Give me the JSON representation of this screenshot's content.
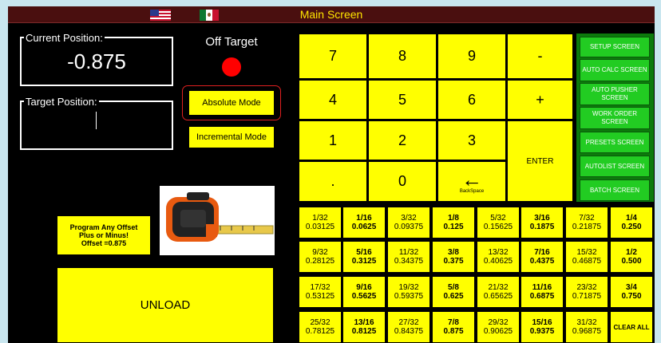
{
  "title": "Main Screen",
  "current": {
    "label": "Current Position:",
    "value": "-0.875"
  },
  "target": {
    "label": "Target Position:"
  },
  "status": {
    "text": "Off Target",
    "color": "#ff0000"
  },
  "modes": {
    "absolute": "Absolute Mode",
    "incremental": "Incremental Mode"
  },
  "keypad": {
    "k7": "7",
    "k8": "8",
    "k9": "9",
    "minus": "-",
    "k4": "4",
    "k5": "5",
    "k6": "6",
    "plus": "+",
    "k1": "1",
    "k2": "2",
    "k3": "3",
    "enter": "ENTER",
    "dot": ".",
    "k0": "0",
    "back_arrow": "←",
    "backspace": "BackSpace"
  },
  "screens": {
    "setup": "SETUP SCREEN",
    "auto_calc": "AUTO CALC SCREEN",
    "auto_pusher": "AUTO PUSHER SCREEN",
    "work_order": "WORK ORDER SCREEN",
    "presets": "PRESETS SCREEN",
    "autolist": "AUTOLIST SCREEN",
    "batch": "BATCH SCREEN"
  },
  "offset": {
    "line1": "Program Any Offset",
    "line2": "Plus or Minus!",
    "line3": "Offset =0.875"
  },
  "unload": "UNLOAD",
  "fractions": {
    "f1": {
      "num": "1/32",
      "dec": "0.03125"
    },
    "f2": {
      "num": "1/16",
      "dec": "0.0625"
    },
    "f3": {
      "num": "3/32",
      "dec": "0.09375"
    },
    "f4": {
      "num": "1/8",
      "dec": "0.125"
    },
    "f5": {
      "num": "5/32",
      "dec": "0.15625"
    },
    "f6": {
      "num": "3/16",
      "dec": "0.1875"
    },
    "f7": {
      "num": "7/32",
      "dec": "0.21875"
    },
    "f8": {
      "num": "1/4",
      "dec": "0.250"
    },
    "f9": {
      "num": "9/32",
      "dec": "0.28125"
    },
    "f10": {
      "num": "5/16",
      "dec": "0.3125"
    },
    "f11": {
      "num": "11/32",
      "dec": "0.34375"
    },
    "f12": {
      "num": "3/8",
      "dec": "0.375"
    },
    "f13": {
      "num": "13/32",
      "dec": "0.40625"
    },
    "f14": {
      "num": "7/16",
      "dec": "0.4375"
    },
    "f15": {
      "num": "15/32",
      "dec": "0.46875"
    },
    "f16": {
      "num": "1/2",
      "dec": "0.500"
    },
    "f17": {
      "num": "17/32",
      "dec": "0.53125"
    },
    "f18": {
      "num": "9/16",
      "dec": "0.5625"
    },
    "f19": {
      "num": "19/32",
      "dec": "0.59375"
    },
    "f20": {
      "num": "5/8",
      "dec": "0.625"
    },
    "f21": {
      "num": "21/32",
      "dec": "0.65625"
    },
    "f22": {
      "num": "11/16",
      "dec": "0.6875"
    },
    "f23": {
      "num": "23/32",
      "dec": "0.71875"
    },
    "f24": {
      "num": "3/4",
      "dec": "0.750"
    },
    "f25": {
      "num": "25/32",
      "dec": "0.78125"
    },
    "f26": {
      "num": "13/16",
      "dec": "0.8125"
    },
    "f27": {
      "num": "27/32",
      "dec": "0.84375"
    },
    "f28": {
      "num": "7/8",
      "dec": "0.875"
    },
    "f29": {
      "num": "29/32",
      "dec": "0.90625"
    },
    "f30": {
      "num": "15/16",
      "dec": "0.9375"
    },
    "f31": {
      "num": "31/32",
      "dec": "0.96875"
    }
  },
  "clear_all": "CLEAR ALL",
  "colors": {
    "button": "#ffff00",
    "screen_button": "#22cc22",
    "title_text": "#ffe600",
    "background": "#000000"
  }
}
